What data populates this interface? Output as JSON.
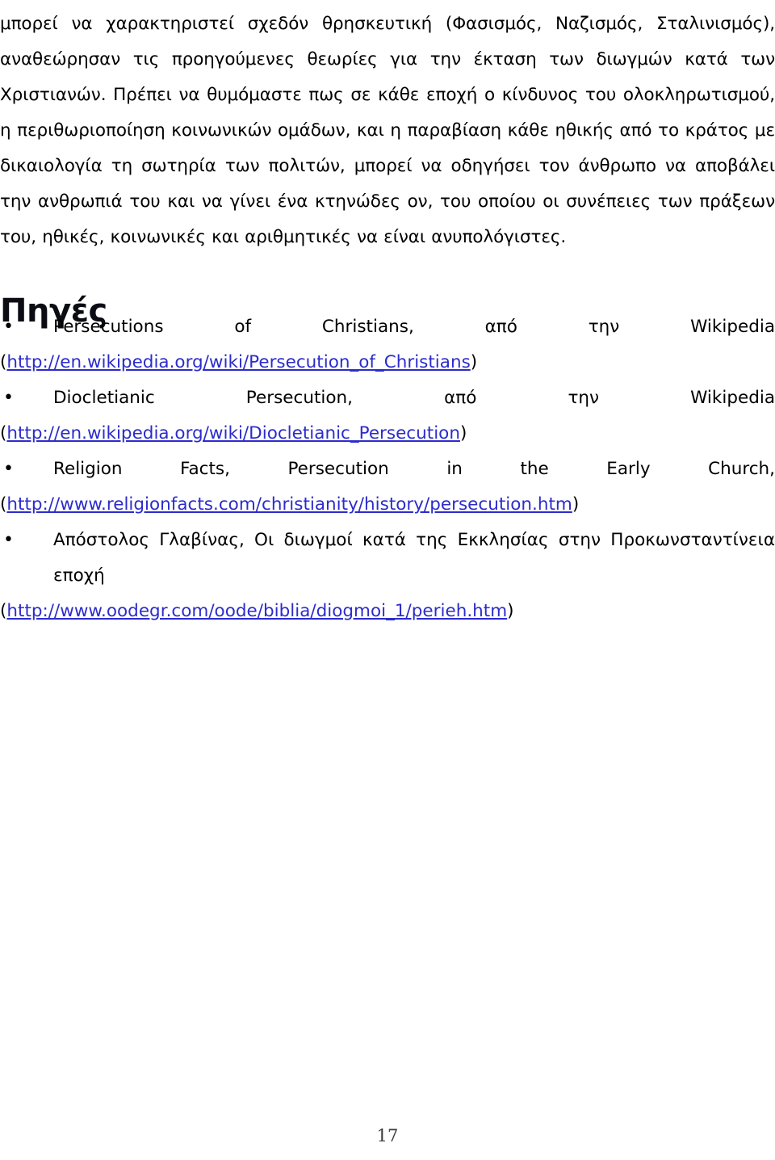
{
  "document": {
    "page_number": "17",
    "link_color": "#2c2ccc",
    "text_color": "#000000",
    "heading_color": "#0c0c14",
    "background_color": "#ffffff"
  },
  "body": {
    "paragraph": "μπορεί να χαρακτηριστεί σχεδόν θρησκευτική (Φασισμός, Ναζισμός, Σταλινισμός), αναθεώρησαν τις προηγούμενες θεωρίες για την έκταση των διωγμών κατά των Χριστιανών. Πρέπει να θυμόμαστε πως σε κάθε εποχή ο κίνδυνος του ολοκληρωτισμού, η περιθωριοποίηση κοινωνικών ομάδων, και η παραβίαση κάθε ηθικής από το κράτος με δικαιολογία τη σωτηρία των πολιτών, μπορεί να οδηγήσει τον άνθρωπο να αποβάλει την ανθρωπιά του και να γίνει ένα κτηνώδες ον, του οποίου οι συνέπειες των πράξεων του, ηθικές, κοινωνικές και αριθμητικές να είναι ανυπολόγιστες."
  },
  "sources": {
    "heading": "Πηγές",
    "bullet_glyph": "•",
    "items": [
      {
        "title": "Persecutions of Christians, από την Wikipedia",
        "url_open_paren": "(",
        "url": "http://en.wikipedia.org/wiki/Persecution_of_Christians",
        "url_close_paren": ")"
      },
      {
        "title": "Diocletianic Persecution, από την Wikipedia",
        "url_open_paren": "(",
        "url": "http://en.wikipedia.org/wiki/Diocletianic_Persecution",
        "url_close_paren": ")"
      },
      {
        "title": "Religion Facts, Persecution in the Early Church,",
        "url_open_paren": "(",
        "url": "http://www.religionfacts.com/christianity/history/persecution.htm",
        "url_close_paren": ")"
      },
      {
        "title": "Απόστολος Γλαβίνας, Οι διωγμοί κατά της Εκκλησίας στην Προκωνσταντίνεια εποχή",
        "url_open_paren": "(",
        "url": "http://www.oodegr.com/oode/biblia/diogmoi_1/perieh.htm",
        "url_close_paren": ")"
      }
    ]
  }
}
